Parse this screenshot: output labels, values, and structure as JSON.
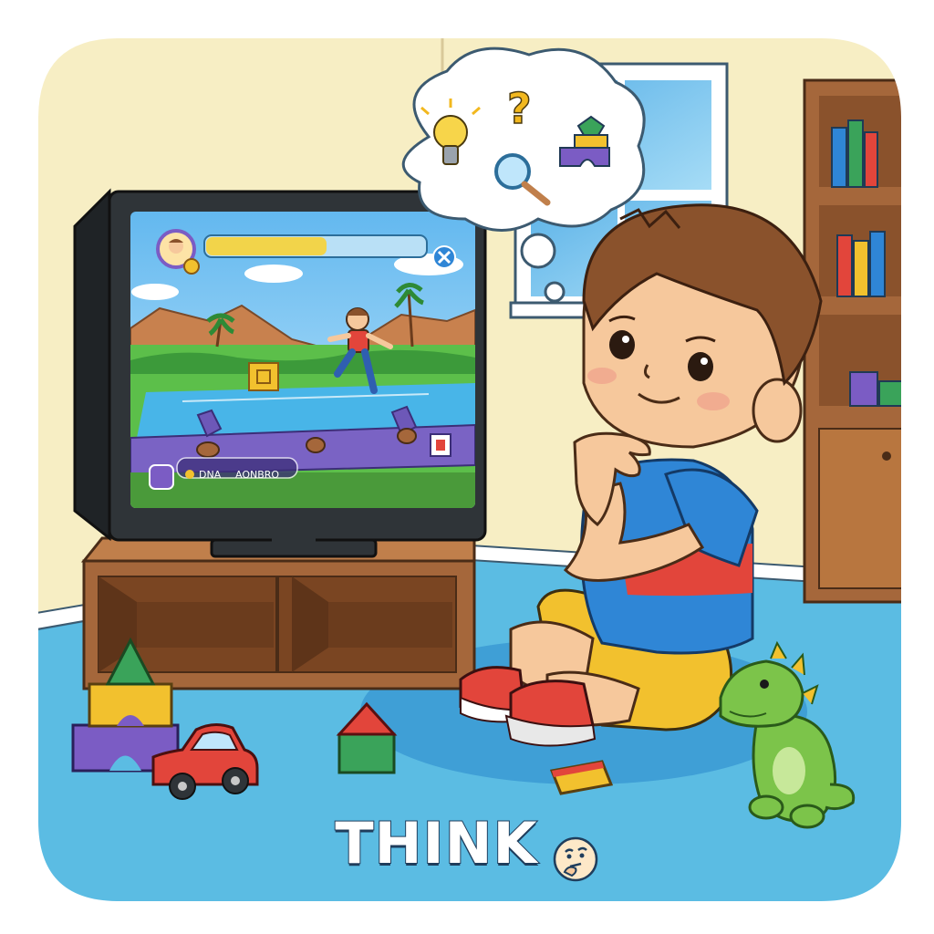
{
  "caption": {
    "word": "THINK",
    "emoji": "thinking-face"
  },
  "game_screen": {
    "hud_labels": [
      "DNA",
      "AONBRO"
    ],
    "progress": 0.55
  },
  "thought_bubble": {
    "icons": [
      "lightbulb-icon",
      "question-mark-icon",
      "magnifier-icon",
      "blocks-icon"
    ]
  },
  "colors": {
    "wall": "#f7eec4",
    "floor": "#5bbce3",
    "rug": "#3f9fd6",
    "tv_frame": "#2f3438",
    "tv_stand": "#a5673b",
    "shirt_blue": "#2f86d6",
    "shirt_red": "#e2453b",
    "shorts": "#f2c12e",
    "dino": "#7cc44a"
  }
}
